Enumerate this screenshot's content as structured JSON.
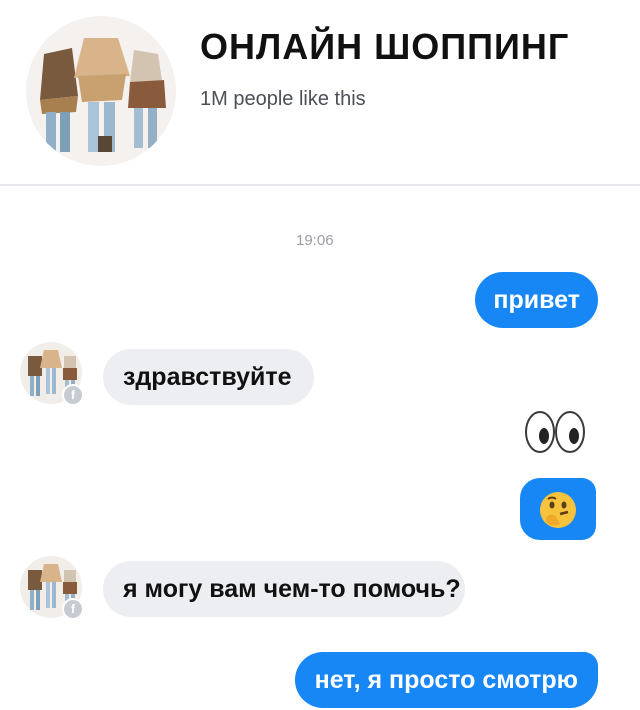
{
  "page": {
    "title": "ОНЛАЙН ШОППИНГ",
    "likes": "1M people like this",
    "avatar_icon": "clothing-collage-avatar"
  },
  "conversation": {
    "timestamp": "19:06",
    "messages": [
      {
        "from": "me",
        "text": "привет"
      },
      {
        "from": "page",
        "text": "здравствуйте"
      },
      {
        "from": "me",
        "emoji": "eyes"
      },
      {
        "from": "me",
        "emoji": "thinking-face"
      },
      {
        "from": "page",
        "text": "я могу вам чем-то помочь?"
      },
      {
        "from": "me",
        "text": "нет, я просто смотрю"
      }
    ]
  },
  "colors": {
    "outgoing_bubble": "#1787f5",
    "incoming_bubble": "#eceef1",
    "divider": "#e6e7ea"
  }
}
